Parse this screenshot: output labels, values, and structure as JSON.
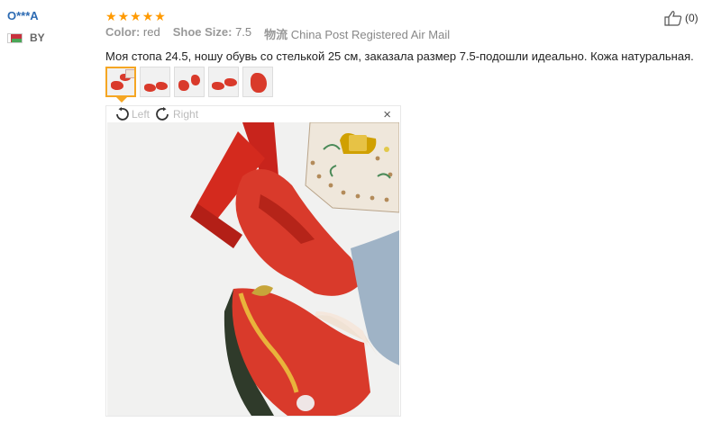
{
  "user": {
    "name": "O***A",
    "country_code": "BY"
  },
  "review": {
    "rating": 5,
    "color_label": "Color:",
    "color_value": "red",
    "size_label": "Shoe Size:",
    "size_value": "7.5",
    "shipping_label": "物流",
    "shipping_value": "China Post Registered Air Mail",
    "text": "Моя стопа 24.5, ношу обувь со стелькой 25 см, заказала размер 7.5-подошли идеально. Кожа натуральная."
  },
  "viewer": {
    "rotate_left": "Left",
    "rotate_right": "Right",
    "close": "×"
  },
  "like": {
    "count": "(0)"
  },
  "colors": {
    "username": "#2d6bb3",
    "star": "#ff9a00",
    "accent": "#f5a623",
    "shoe": "#d93a2b"
  }
}
